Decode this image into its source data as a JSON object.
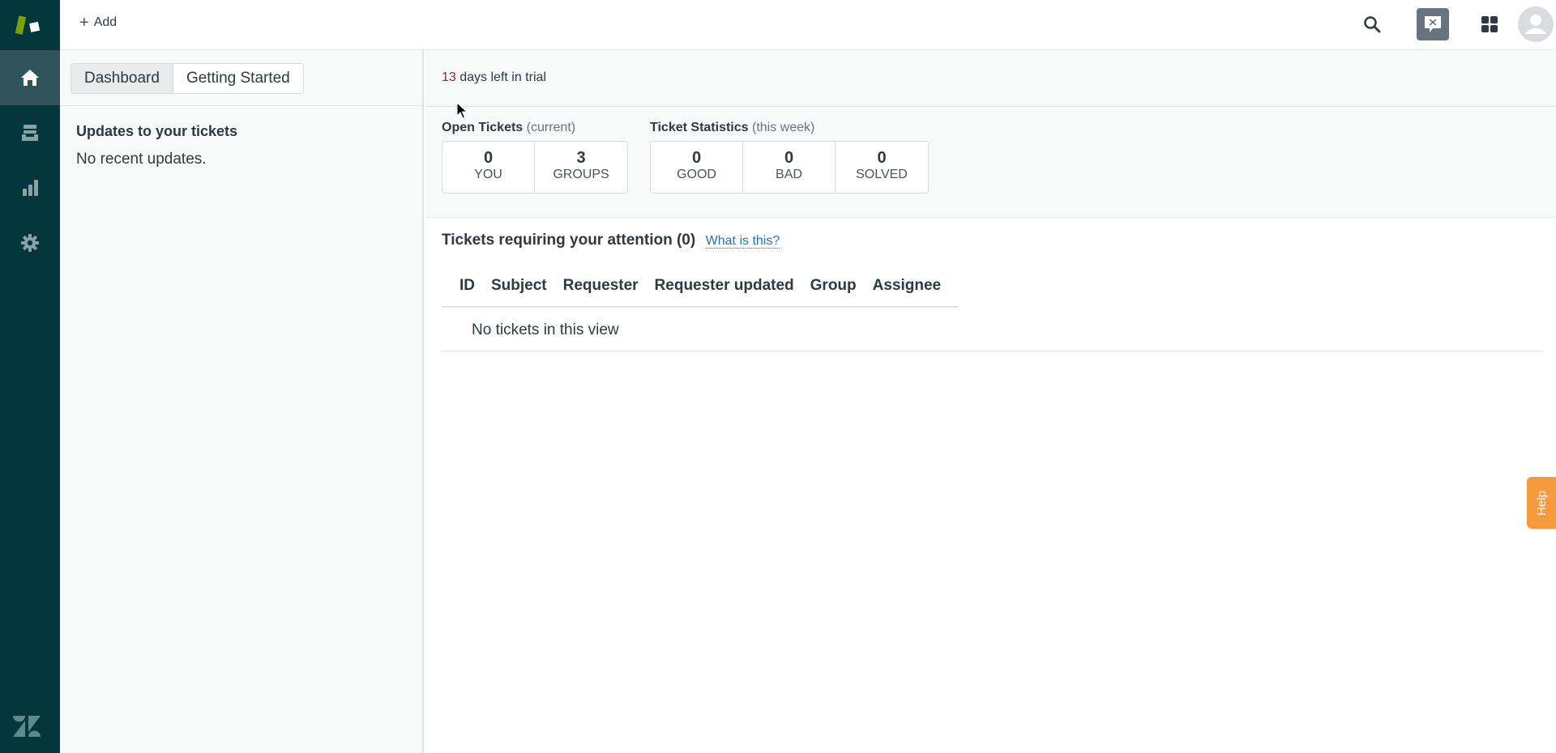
{
  "nav": {
    "items": [
      {
        "name": "home",
        "icon": "home-icon",
        "active": true
      },
      {
        "name": "views",
        "icon": "inbox-icon",
        "active": false
      },
      {
        "name": "reporting",
        "icon": "bar-chart-icon",
        "active": false
      },
      {
        "name": "admin",
        "icon": "gear-icon",
        "active": false
      }
    ],
    "colors": {
      "bg": "#03363d",
      "active": "#30545a",
      "icon": "#87a3a6"
    }
  },
  "topbar": {
    "add_label": "Add",
    "icons": [
      "search-icon",
      "chat-close-icon",
      "apps-grid-icon",
      "user-avatar-icon"
    ]
  },
  "leftpanel": {
    "tabs": [
      {
        "label": "Dashboard",
        "active": true
      },
      {
        "label": "Getting Started",
        "active": false
      }
    ],
    "updates_title": "Updates to your tickets",
    "updates_empty": "No recent updates."
  },
  "trial": {
    "days": "13",
    "text": "days left in trial",
    "days_color": "#a71d3f"
  },
  "open_tickets": {
    "title": "Open Tickets",
    "subtitle": "(current)",
    "stats": [
      {
        "value": "0",
        "label": "YOU"
      },
      {
        "value": "3",
        "label": "GROUPS"
      }
    ]
  },
  "ticket_statistics": {
    "title": "Ticket Statistics",
    "subtitle": "(this week)",
    "stats": [
      {
        "value": "0",
        "label": "GOOD"
      },
      {
        "value": "0",
        "label": "BAD"
      },
      {
        "value": "0",
        "label": "SOLVED"
      }
    ]
  },
  "attention": {
    "title": "Tickets requiring your attention (0)",
    "help_link": "What is this?",
    "columns": [
      "ID",
      "Subject",
      "Requester",
      "Requester updated",
      "Group",
      "Assignee"
    ],
    "empty": "No tickets in this view"
  },
  "help_tab": {
    "label": "Help",
    "color": "#f79a3e"
  }
}
